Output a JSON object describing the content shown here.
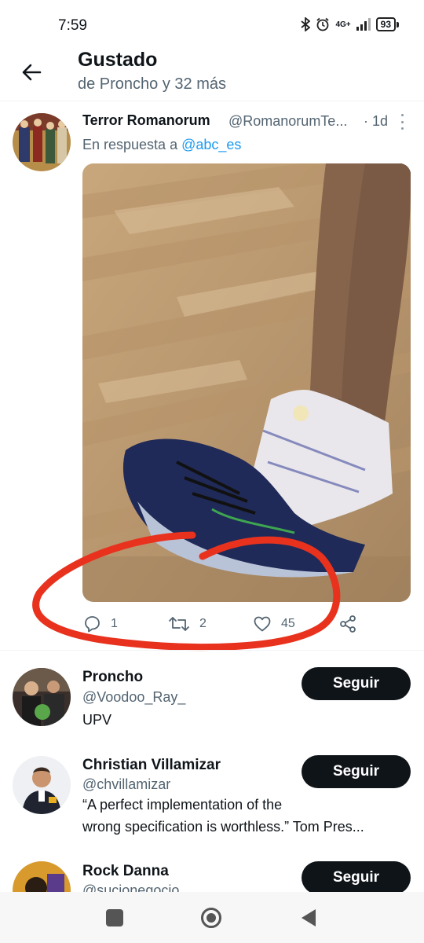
{
  "status_bar": {
    "time": "7:59",
    "network": "4G+",
    "battery": "93"
  },
  "header": {
    "title": "Gustado",
    "subtitle": "de Proncho y 32 más"
  },
  "tweet": {
    "author_name": "Terror Romanorum",
    "author_handle": "@RomanorumTe...",
    "time": "· 1d",
    "reply_prefix": "En respuesta a",
    "reply_mention": "@abc_es",
    "replies": "1",
    "retweets": "2",
    "likes": "45"
  },
  "users": [
    {
      "name": "Proncho",
      "handle": "@Voodoo_Ray_",
      "bio": "UPV",
      "follow_label": "Seguir"
    },
    {
      "name": "Christian Villamizar",
      "handle": "@chvillamizar",
      "bio_line1": "“A perfect implementation of the",
      "bio_line2": "wrong specification is worthless.” Tom Pres...",
      "follow_label": "Seguir"
    },
    {
      "name": "Rock Danna",
      "handle": "@sucionegocio",
      "follow_label": "Seguir"
    }
  ],
  "colors": {
    "accent": "#1d9bf0",
    "annotation": "#e8321e",
    "text": "#0f1419",
    "muted": "#536471"
  },
  "icons": [
    "back-arrow-icon",
    "reply-icon",
    "retweet-icon",
    "like-icon",
    "share-icon",
    "more-icon",
    "recents-icon",
    "home-icon",
    "back-icon"
  ]
}
